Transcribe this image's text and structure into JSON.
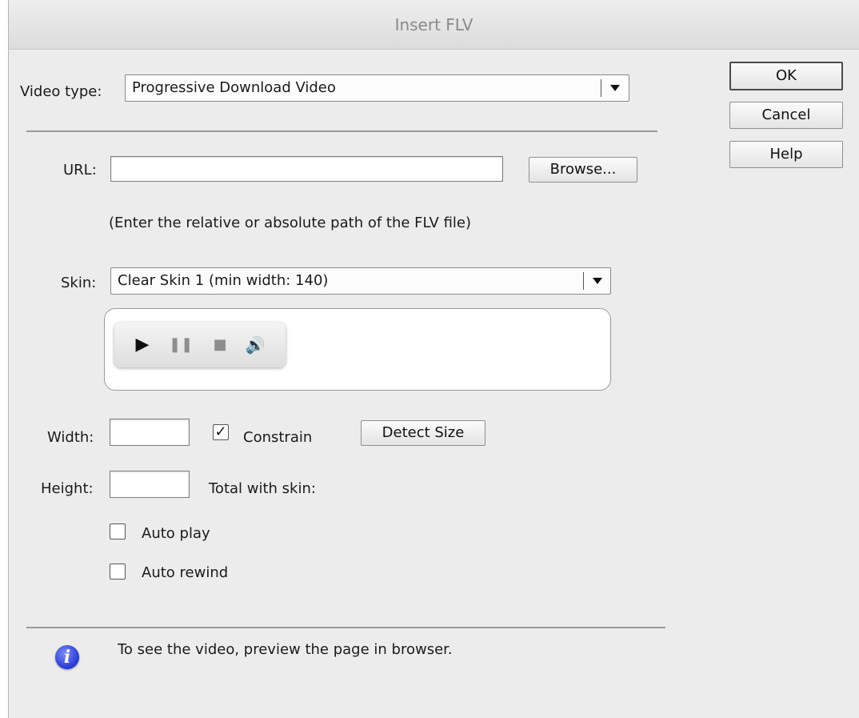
{
  "window": {
    "title": "Insert FLV"
  },
  "buttons": {
    "ok": "OK",
    "cancel": "Cancel",
    "help": "Help"
  },
  "video_type": {
    "label": "Video type:",
    "selected": "Progressive Download Video"
  },
  "url": {
    "label": "URL:",
    "value": "",
    "browse": "Browse...",
    "hint": "(Enter the relative or absolute path of the FLV file)"
  },
  "skin": {
    "label": "Skin:",
    "selected": "Clear Skin 1 (min width: 140)"
  },
  "preview_controls": {
    "play": "▶",
    "pause": "❚❚",
    "stop": "■",
    "volume": "🔊"
  },
  "size": {
    "width_label": "Width:",
    "width_value": "",
    "height_label": "Height:",
    "height_value": "",
    "constrain_label": "Constrain",
    "constrain_checked": true,
    "constrain_mark": "✓",
    "detect_button": "Detect Size",
    "total_label": "Total with skin:"
  },
  "options": {
    "auto_play": {
      "label": "Auto play",
      "checked": false
    },
    "auto_rewind": {
      "label": "Auto rewind",
      "checked": false
    }
  },
  "info": {
    "icon_glyph": "i",
    "text": "To see the video, preview the page in browser."
  }
}
